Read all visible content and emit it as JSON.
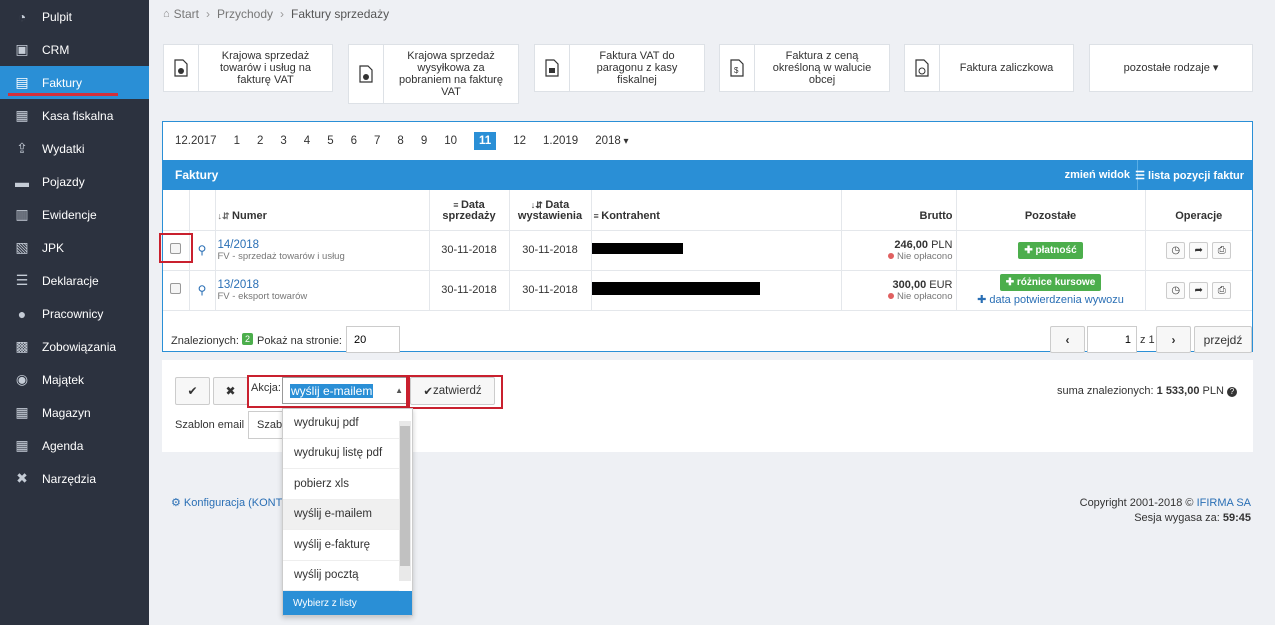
{
  "sidebar": {
    "items": [
      {
        "label": "Pulpit",
        "icon": "dashboard-icon"
      },
      {
        "label": "CRM",
        "icon": "crm-icon"
      },
      {
        "label": "Faktury",
        "icon": "invoice-icon",
        "active": true
      },
      {
        "label": "Kasa fiskalna",
        "icon": "cash-register-icon"
      },
      {
        "label": "Wydatki",
        "icon": "expenses-icon"
      },
      {
        "label": "Pojazdy",
        "icon": "truck-icon"
      },
      {
        "label": "Ewidencje",
        "icon": "records-icon"
      },
      {
        "label": "JPK",
        "icon": "jpk-icon"
      },
      {
        "label": "Deklaracje",
        "icon": "declarations-icon"
      },
      {
        "label": "Pracownicy",
        "icon": "employees-icon"
      },
      {
        "label": "Zobowiązania",
        "icon": "liabilities-icon"
      },
      {
        "label": "Majątek",
        "icon": "camera-icon"
      },
      {
        "label": "Magazyn",
        "icon": "warehouse-icon"
      },
      {
        "label": "Agenda",
        "icon": "calendar-icon"
      },
      {
        "label": "Narzędzia",
        "icon": "tools-icon"
      }
    ]
  },
  "breadcrumb": {
    "home": "Start",
    "level1": "Przychody",
    "level2": "Faktury sprzedaży"
  },
  "doc_types": [
    {
      "label": "Krajowa sprzedaż towarów i usług na fakturę VAT"
    },
    {
      "label": "Krajowa sprzedaż wysyłkowa za pobraniem na fakturę VAT"
    },
    {
      "label": "Faktura VAT do paragonu z kasy fiskalnej"
    },
    {
      "label": "Faktura z ceną określoną w walucie obcej"
    },
    {
      "label": "Faktura zaliczkowa"
    },
    {
      "label": "pozostałe rodzaje ▾"
    }
  ],
  "months": [
    "12.2017",
    "1",
    "2",
    "3",
    "4",
    "5",
    "6",
    "7",
    "8",
    "9",
    "10",
    "11",
    "12",
    "1.2019",
    "2018"
  ],
  "selected_month": "11",
  "panel": {
    "title": "Faktury",
    "change_view": "zmień widok",
    "position_list": "lista pozycji faktur"
  },
  "table": {
    "headers": {
      "numer": "Numer",
      "data_sprzedazy": "Data sprzedaży",
      "data_wystawienia": "Data wystawienia",
      "kontrahent": "Kontrahent",
      "brutto": "Brutto",
      "pozostale": "Pozostałe",
      "operacje": "Operacje"
    },
    "rows": [
      {
        "numer": "14/2018",
        "typ": "FV - sprzedaż towarów i usług",
        "data_sprzedazy": "30-11-2018",
        "data_wystawienia": "30-11-2018",
        "brutto": "246,00",
        "waluta": "PLN",
        "status": "Nie opłacono",
        "akcja1": "płatność",
        "akcja2": ""
      },
      {
        "numer": "13/2018",
        "typ": "FV - eksport towarów",
        "data_sprzedazy": "30-11-2018",
        "data_wystawienia": "30-11-2018",
        "brutto": "300,00",
        "waluta": "EUR",
        "status": "Nie opłacono",
        "akcja1": "różnice kursowe",
        "akcja2": "data potwierdzenia wywozu"
      }
    ]
  },
  "pagination": {
    "found_label": "Znalezionych:",
    "found_count": "2",
    "per_page_label": "Pokaż na stronie:",
    "per_page": "20",
    "page": "1",
    "of_pages": "z 1",
    "goto": "przejdź"
  },
  "actions": {
    "label": "Akcja:",
    "selected": "wyślij e-mailem",
    "submit": "zatwierdź",
    "template_label": "Szablon email",
    "template_value": "Szab",
    "sum_label": "suma znalezionych:",
    "sum_value": "1 533,00",
    "sum_currency": "PLN"
  },
  "dropdown": {
    "options": [
      "wydrukuj pdf",
      "wydrukuj listę pdf",
      "pobierz xls",
      "wyślij e-mailem",
      "wyślij e-fakturę",
      "wyślij pocztą"
    ],
    "footer": "Wybierz z listy"
  },
  "footer": {
    "config": "Konfiguracja (KONT",
    "copyright": "Copyright 2001-2018 ©",
    "brand": "IFIRMA SA",
    "session_label": "Sesja wygasa za:",
    "session_time": "59:45"
  }
}
